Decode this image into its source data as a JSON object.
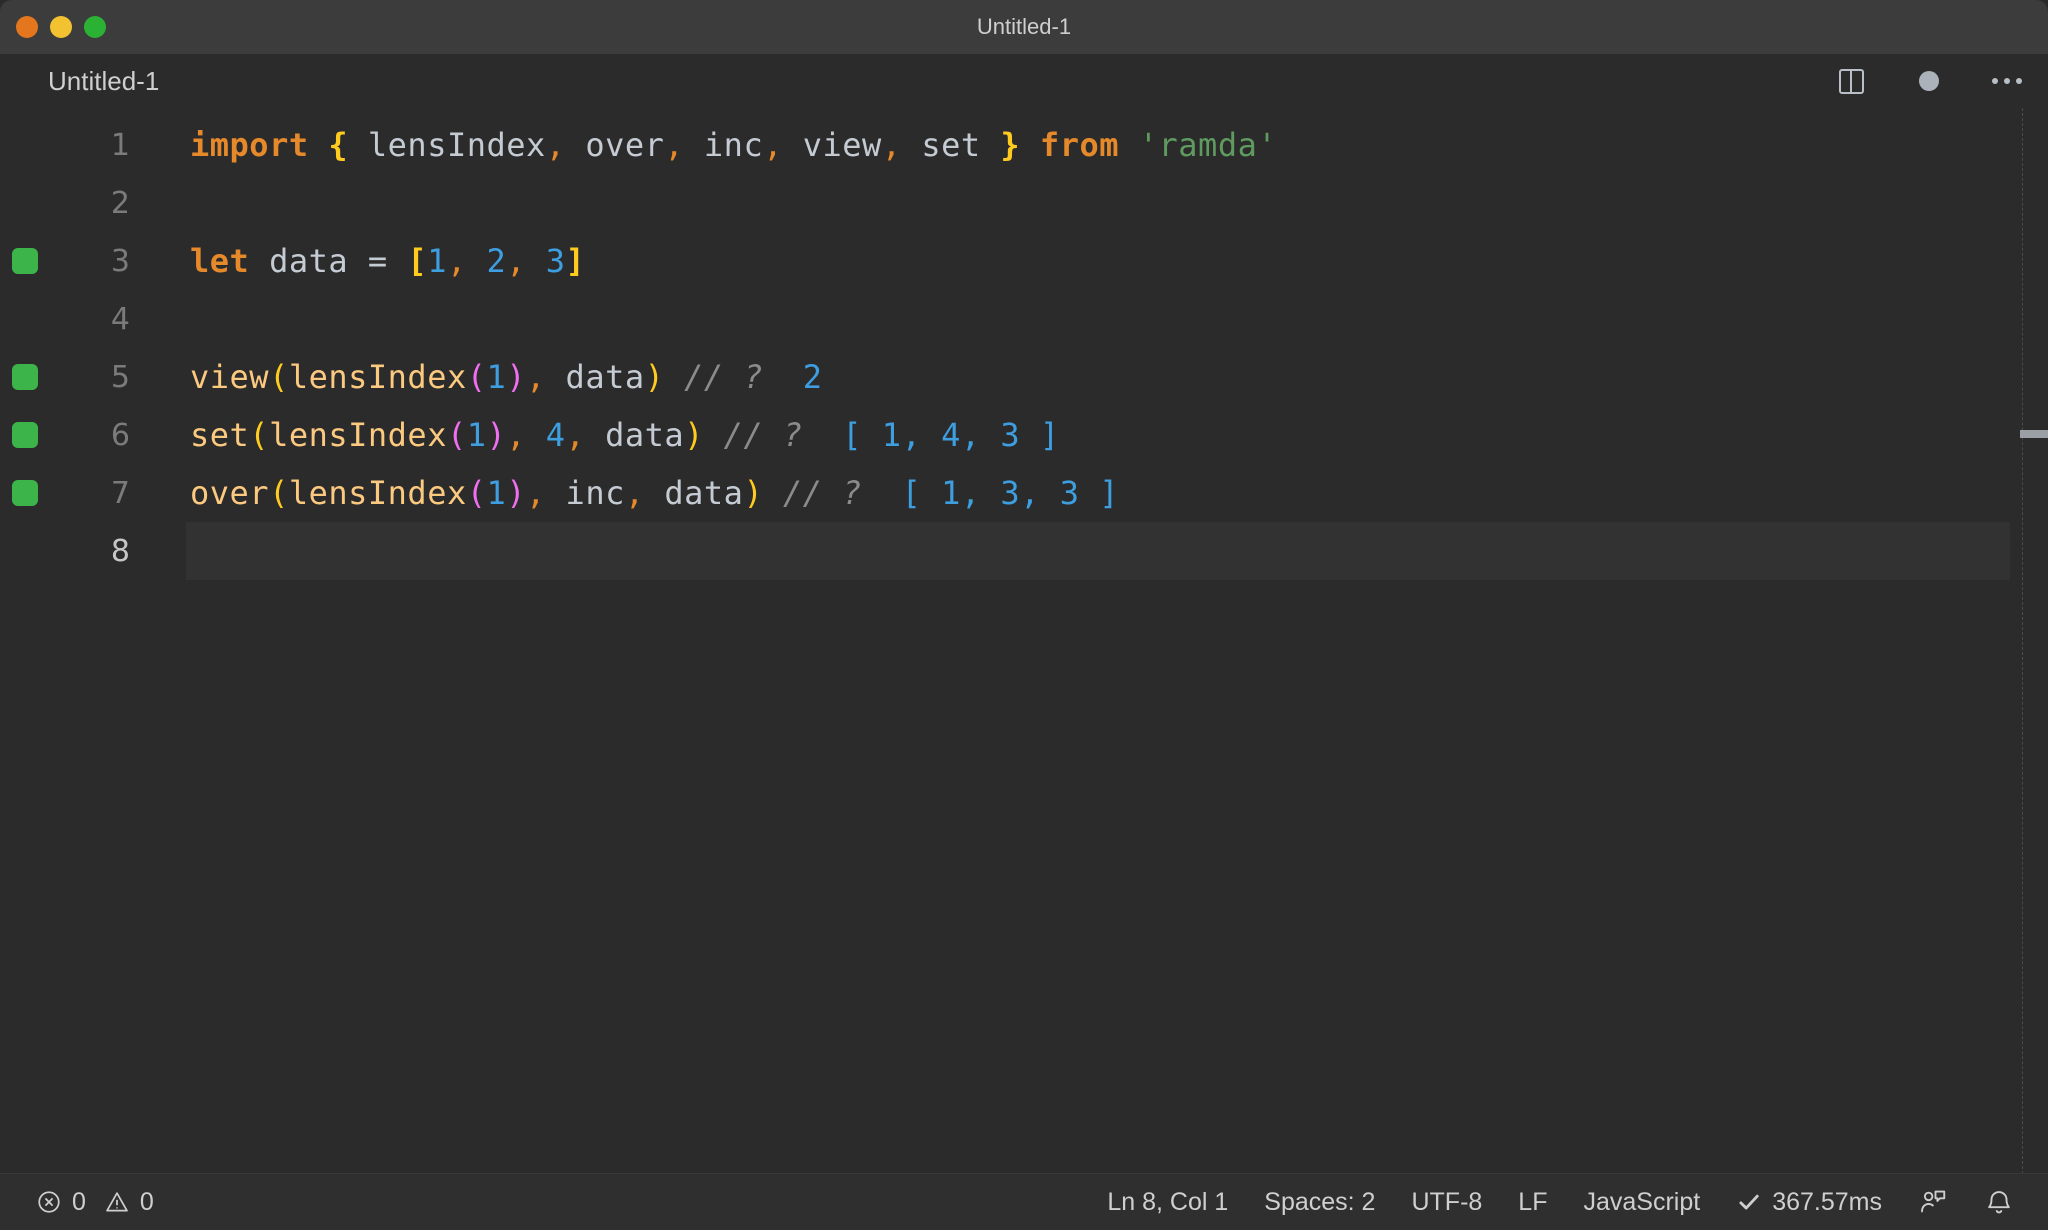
{
  "window": {
    "title": "Untitled-1",
    "traffic_lights": [
      {
        "name": "close",
        "color": "#e4761d"
      },
      {
        "name": "minimize",
        "color": "#f2c230"
      },
      {
        "name": "maximize",
        "color": "#2bb134"
      }
    ]
  },
  "tab": {
    "label": "Untitled-1",
    "dirty": true
  },
  "editor_actions": [
    {
      "name": "split-editor-icon",
      "label": "Split Editor"
    },
    {
      "name": "unsaved-dot-icon",
      "label": "Unsaved"
    },
    {
      "name": "more-actions-icon",
      "label": "More Actions..."
    }
  ],
  "editor": {
    "active_line": 8,
    "lines": [
      {
        "number": "1",
        "marked": false,
        "active": false,
        "tokens": [
          {
            "t": "import",
            "c": "kw"
          },
          {
            "t": " ",
            "c": "punct"
          },
          {
            "t": "{",
            "c": "brace"
          },
          {
            "t": " lensIndex",
            "c": "ident"
          },
          {
            "t": ",",
            "c": "comma"
          },
          {
            "t": " over",
            "c": "ident"
          },
          {
            "t": ",",
            "c": "comma"
          },
          {
            "t": " inc",
            "c": "ident"
          },
          {
            "t": ",",
            "c": "comma"
          },
          {
            "t": " view",
            "c": "ident"
          },
          {
            "t": ",",
            "c": "comma"
          },
          {
            "t": " set ",
            "c": "ident"
          },
          {
            "t": "}",
            "c": "brace"
          },
          {
            "t": " ",
            "c": "punct"
          },
          {
            "t": "from",
            "c": "kw"
          },
          {
            "t": " ",
            "c": "punct"
          },
          {
            "t": "'ramda'",
            "c": "str"
          }
        ]
      },
      {
        "number": "2",
        "marked": false,
        "active": false,
        "tokens": []
      },
      {
        "number": "3",
        "marked": true,
        "active": false,
        "tokens": [
          {
            "t": "let",
            "c": "kw"
          },
          {
            "t": " data ",
            "c": "ident"
          },
          {
            "t": "=",
            "c": "punct"
          },
          {
            "t": " ",
            "c": "punct"
          },
          {
            "t": "[",
            "c": "bracket"
          },
          {
            "t": "1",
            "c": "num"
          },
          {
            "t": ",",
            "c": "comma"
          },
          {
            "t": " ",
            "c": "punct"
          },
          {
            "t": "2",
            "c": "num"
          },
          {
            "t": ",",
            "c": "comma"
          },
          {
            "t": " ",
            "c": "punct"
          },
          {
            "t": "3",
            "c": "num"
          },
          {
            "t": "]",
            "c": "bracket"
          }
        ]
      },
      {
        "number": "4",
        "marked": false,
        "active": false,
        "tokens": []
      },
      {
        "number": "5",
        "marked": true,
        "active": false,
        "tokens": [
          {
            "t": "view",
            "c": "fn"
          },
          {
            "t": "(",
            "c": "paren1"
          },
          {
            "t": "lensIndex",
            "c": "fn"
          },
          {
            "t": "(",
            "c": "paren2"
          },
          {
            "t": "1",
            "c": "num"
          },
          {
            "t": ")",
            "c": "paren2"
          },
          {
            "t": ",",
            "c": "comma"
          },
          {
            "t": " data",
            "c": "ident"
          },
          {
            "t": ")",
            "c": "paren1"
          },
          {
            "t": " ",
            "c": "punct"
          },
          {
            "t": "// ?",
            "c": "comment"
          },
          {
            "t": "  ",
            "c": "punct"
          },
          {
            "t": "2",
            "c": "result"
          }
        ]
      },
      {
        "number": "6",
        "marked": true,
        "active": false,
        "tokens": [
          {
            "t": "set",
            "c": "fn"
          },
          {
            "t": "(",
            "c": "paren1"
          },
          {
            "t": "lensIndex",
            "c": "fn"
          },
          {
            "t": "(",
            "c": "paren2"
          },
          {
            "t": "1",
            "c": "num"
          },
          {
            "t": ")",
            "c": "paren2"
          },
          {
            "t": ",",
            "c": "comma"
          },
          {
            "t": " ",
            "c": "punct"
          },
          {
            "t": "4",
            "c": "num"
          },
          {
            "t": ",",
            "c": "comma"
          },
          {
            "t": " data",
            "c": "ident"
          },
          {
            "t": ")",
            "c": "paren1"
          },
          {
            "t": " ",
            "c": "punct"
          },
          {
            "t": "// ?",
            "c": "comment"
          },
          {
            "t": "  ",
            "c": "punct"
          },
          {
            "t": "[ 1, 4, 3 ]",
            "c": "result"
          }
        ]
      },
      {
        "number": "7",
        "marked": true,
        "active": false,
        "tokens": [
          {
            "t": "over",
            "c": "fn"
          },
          {
            "t": "(",
            "c": "paren1"
          },
          {
            "t": "lensIndex",
            "c": "fn"
          },
          {
            "t": "(",
            "c": "paren2"
          },
          {
            "t": "1",
            "c": "num"
          },
          {
            "t": ")",
            "c": "paren2"
          },
          {
            "t": ",",
            "c": "comma"
          },
          {
            "t": " inc",
            "c": "ident"
          },
          {
            "t": ",",
            "c": "comma"
          },
          {
            "t": " data",
            "c": "ident"
          },
          {
            "t": ")",
            "c": "paren1"
          },
          {
            "t": " ",
            "c": "punct"
          },
          {
            "t": "// ?",
            "c": "comment"
          },
          {
            "t": "  ",
            "c": "punct"
          },
          {
            "t": "[ 1, 3, 3 ]",
            "c": "result"
          }
        ]
      },
      {
        "number": "8",
        "marked": false,
        "active": true,
        "tokens": []
      }
    ]
  },
  "statusbar": {
    "errors": "0",
    "warnings": "0",
    "cursor_position": "Ln 8, Col 1",
    "indentation": "Spaces: 2",
    "encoding": "UTF-8",
    "eol": "LF",
    "language": "JavaScript",
    "run_time": "367.57ms",
    "run_status_icon": "check-icon",
    "feedback_icon": "feedback-person-icon",
    "notifications_icon": "bell-icon"
  },
  "colors": {
    "editor_background": "#2b2b2b",
    "titlebar_background": "#3c3c3c",
    "statusbar_background": "#2f2f2f",
    "keyword": "#e5892a",
    "brace": "#ffcb1f",
    "number": "#3d9ee0",
    "string": "#5f9a5f",
    "function": "#fbc97f",
    "paren_magenta": "#f06ff0",
    "comment": "#8b8b8b",
    "coverage_marker": "#3cb44a"
  }
}
